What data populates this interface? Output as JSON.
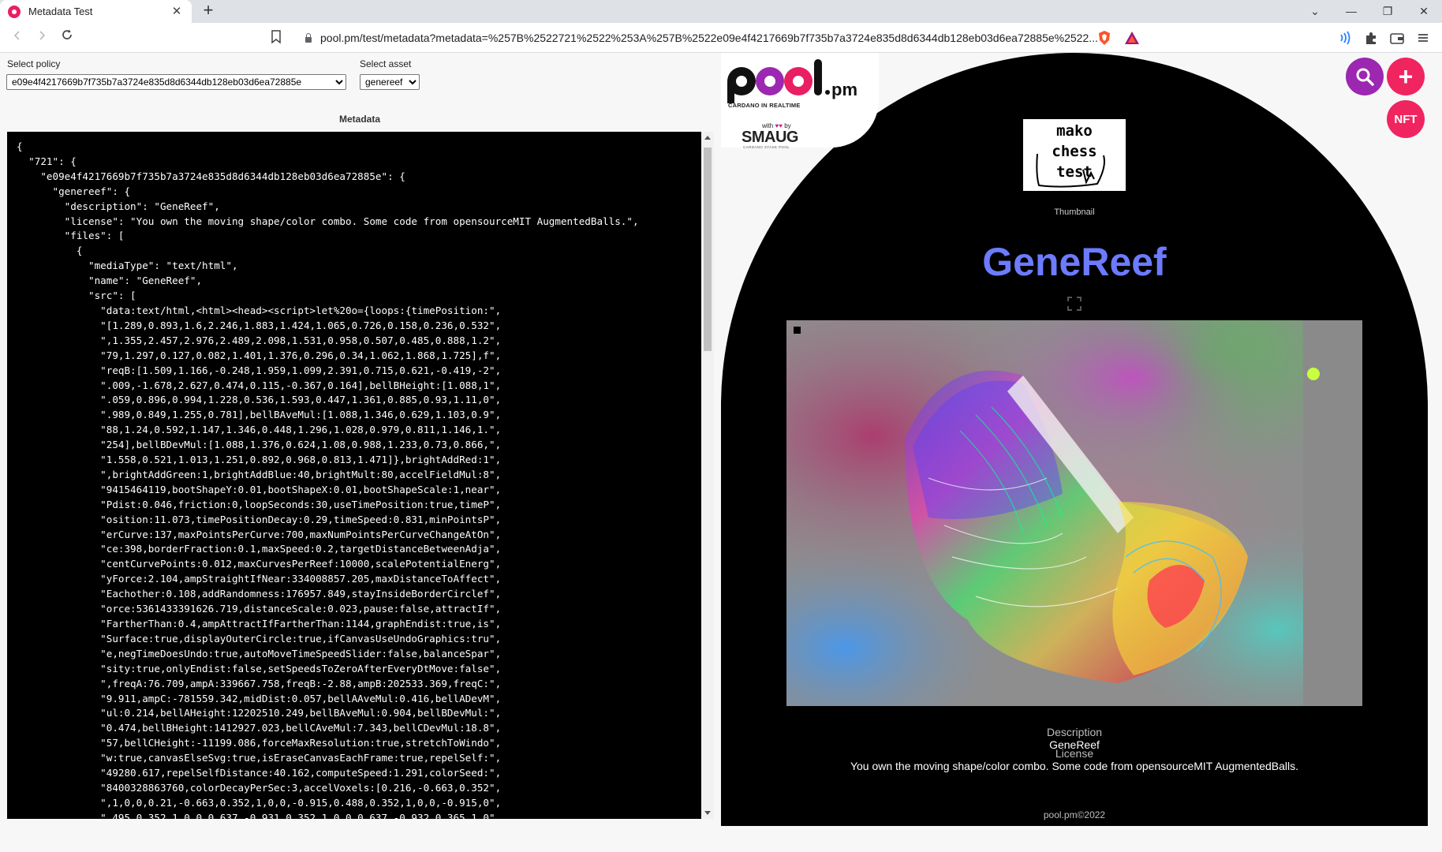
{
  "browser": {
    "tab_title": "Metadata Test",
    "tab_close": "✕",
    "new_tab": "+",
    "url": "pool.pm/test/metadata?metadata=%257B%2522721%2522%253A%257B%2522e09e4f4217669b7f735b7a3724e835d8d6344db128eb03d6ea72885e%2522...",
    "window_controls": [
      "⌄",
      "—",
      "❐",
      "✕"
    ]
  },
  "controls": {
    "policy_label": "Select policy",
    "policy_value": "e09e4f4217669b7f735b7a3724e835d8d6344db128eb03d6ea72885e",
    "asset_label": "Select asset",
    "asset_value": "genereef"
  },
  "metadata": {
    "heading": "Metadata",
    "json_text": "{\n  \"721\": {\n    \"e09e4f4217669b7f735b7a3724e835d8d6344db128eb03d6ea72885e\": {\n      \"genereef\": {\n        \"description\": \"GeneReef\",\n        \"license\": \"You own the moving shape/color combo. Some code from opensourceMIT AugmentedBalls.\",\n        \"files\": [\n          {\n            \"mediaType\": \"text/html\",\n            \"name\": \"GeneReef\",\n            \"src\": [\n              \"data:text/html,<html><head><script>let%20o={loops:{timePosition:\",\n              \"[1.289,0.893,1.6,2.246,1.883,1.424,1.065,0.726,0.158,0.236,0.532\",\n              \",1.355,2.457,2.976,2.489,2.098,1.531,0.958,0.507,0.485,0.888,1.2\",\n              \"79,1.297,0.127,0.082,1.401,1.376,0.296,0.34,1.062,1.868,1.725],f\",\n              \"reqB:[1.509,1.166,-0.248,1.959,1.099,2.391,0.715,0.621,-0.419,-2\",\n              \".009,-1.678,2.627,0.474,0.115,-0.367,0.164],bellBHeight:[1.088,1\",\n              \".059,0.896,0.994,1.228,0.536,1.593,0.447,1.361,0.885,0.93,1.11,0\",\n              \".989,0.849,1.255,0.781],bellBAveMul:[1.088,1.346,0.629,1.103,0.9\",\n              \"88,1.24,0.592,1.147,1.346,0.448,1.296,1.028,0.979,0.811,1.146,1.\",\n              \"254],bellBDevMul:[1.088,1.376,0.624,1.08,0.988,1.233,0.73,0.866,\",\n              \"1.558,0.521,1.013,1.251,0.892,0.968,0.813,1.471]},brightAddRed:1\",\n              \",brightAddGreen:1,brightAddBlue:40,brightMult:80,accelFieldMul:8\",\n              \"9415464119,bootShapeY:0.01,bootShapeX:0.01,bootShapeScale:1,near\",\n              \"Pdist:0.046,friction:0,loopSeconds:30,useTimePosition:true,timeP\",\n              \"osition:11.073,timePositionDecay:0.29,timeSpeed:0.831,minPointsP\",\n              \"erCurve:137,maxPointsPerCurve:700,maxNumPointsPerCurveChangeAtOn\",\n              \"ce:398,borderFraction:0.1,maxSpeed:0.2,targetDistanceBetweenAdja\",\n              \"centCurvePoints:0.012,maxCurvesPerReef:10000,scalePotentialEnerg\",\n              \"yForce:2.104,ampStraightIfNear:334008857.205,maxDistanceToAffect\",\n              \"Eachother:0.108,addRandomness:176957.849,stayInsideBorderCirclef\",\n              \"orce:5361433391626.719,distanceScale:0.023,pause:false,attractIf\",\n              \"FartherThan:0.4,ampAttractIfFartherThan:1144,graphEndist:true,is\",\n              \"Surface:true,displayOuterCircle:true,ifCanvasUseUndoGraphics:tru\",\n              \"e,negTimeDoesUndo:true,autoMoveTimeSpeedSlider:false,balanceSpar\",\n              \"sity:true,onlyEndist:false,setSpeedsToZeroAfterEveryDtMove:false\",\n              \",freqA:76.709,ampA:339667.758,freqB:-2.88,ampB:202533.369,freqC:\",\n              \"9.911,ampC:-781559.342,midDist:0.057,bellAAveMul:0.416,bellADevM\",\n              \"ul:0.214,bellAHeight:12202510.249,bellBAveMul:0.904,bellBDevMul:\",\n              \"0.474,bellBHeight:1412927.023,bellCAveMul:7.343,bellCDevMul:18.8\",\n              \"57,bellCHeight:-11199.086,forceMaxResolution:true,stretchToWindo\",\n              \"w:true,canvasElseSvg:true,isEraseCanvasEachFrame:true,repelSelf:\",\n              \"49280.617,repelSelfDistance:40.162,computeSpeed:1.291,colorSeed:\",\n              \"8400328863760,colorDecayPerSec:3,accelVoxels:[0.216,-0.663,0.352\",\n              \",1,0,0,0.21,-0.663,0.352,1,0,0,-0.915,0.488,0.352,1,0,0,-0.915,0\",\n              \".495,0.352,1,0,0,0.637,-0.931,0.352,1,0,0,0.637,-0.932,0.365,1,0\""
  },
  "nft_view": {
    "logo_text": "pool.pm",
    "logo_tagline": "CARDANO IN REALTIME",
    "sponsor_with": "with",
    "sponsor_by": "by",
    "sponsor_name": "SMAUG",
    "sponsor_sub": "CARDANO STAKE POOL",
    "thumbnail_lines": [
      "mako",
      "chess",
      "test"
    ],
    "thumbnail_label": "Thumbnail",
    "title": "GeneReef",
    "description_label": "Description",
    "description_value": "GeneReef",
    "license_label": "License",
    "license_value": "You own the moving shape/color combo. Some code from opensourceMIT AugmentedBalls.",
    "footer": "pool.pm©2022",
    "accent_title_color": "#6c7bff"
  },
  "fabs": {
    "search_icon": "search-icon",
    "add_label": "+",
    "nft_label": "NFT"
  }
}
